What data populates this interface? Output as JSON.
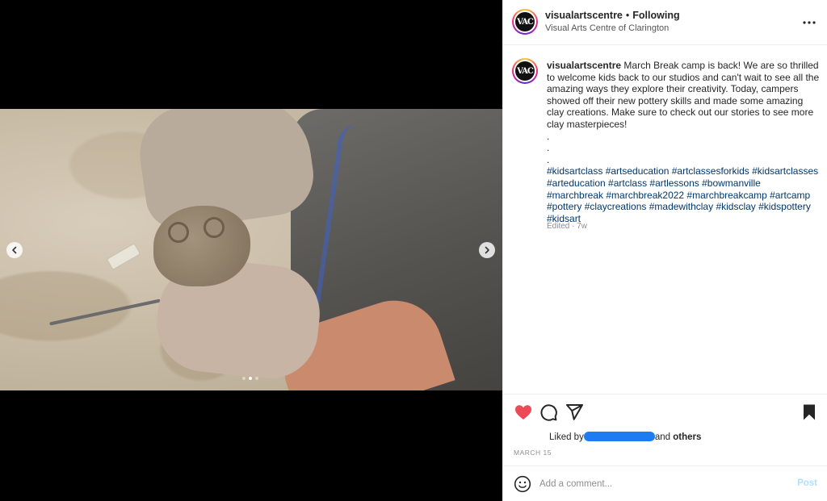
{
  "header": {
    "avatar_logo": "VAC",
    "username": "visualartscentre",
    "separator": "•",
    "following_label": "Following",
    "location": "Visual Arts Centre of Clarington",
    "more_icon": "more-horizontal-icon"
  },
  "media": {
    "prev_icon": "chevron-left-icon",
    "next_icon": "chevron-right-icon",
    "carousel": {
      "count": 3,
      "active_index": 1
    }
  },
  "caption": {
    "username": "visualartscentre",
    "text": "March Break camp is back! We are so thrilled to welcome kids back to our studios and can't wait to see all the amazing ways they explore their creativity. Today, campers showed off their new pottery skills and made some amazing clay creations. Make sure to check out our stories to see more clay masterpieces!",
    "dots": [
      ".",
      ".",
      "."
    ],
    "hashtags": "#kidsartclass #artseducation #artclassesforkids #kidsartclasses #arteducation #artclass #artlessons #bowmanville #marchbreak #marchbreak2022 #marchbreakcamp #artcamp #pottery #claycreations #madewithclay #kidsclay #kidspottery #kidsart",
    "edited": "Edited · 7w"
  },
  "actions": {
    "like_icon": "heart-filled-icon",
    "comment_icon": "comment-icon",
    "share_icon": "paper-plane-icon",
    "save_icon": "bookmark-filled-icon",
    "like_color": "#ed4956",
    "liked_by_prefix": "Liked by",
    "liked_by_suffix": "and",
    "others": "others",
    "date": "MARCH 15"
  },
  "comment": {
    "emoji_icon": "smiley-icon",
    "placeholder": "Add a comment...",
    "post_label": "Post"
  }
}
